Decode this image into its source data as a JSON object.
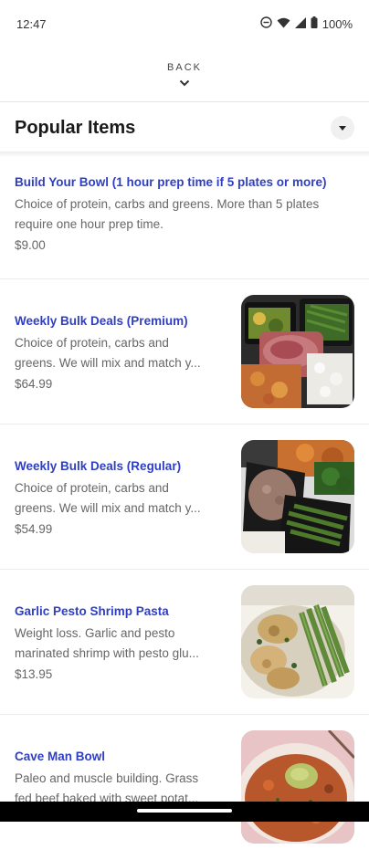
{
  "status_bar": {
    "time": "12:47",
    "battery": "100%",
    "icons": [
      "do-not-disturb-icon",
      "wifi-icon",
      "cell-signal-icon",
      "battery-icon"
    ]
  },
  "header": {
    "back_label": "BACK",
    "back_icon": "chevron-down-icon"
  },
  "section": {
    "title": "Popular Items",
    "toggle_icon": "caret-down-icon"
  },
  "items": [
    {
      "name": "Build Your Bowl (1 hour prep time if 5 plates or more)",
      "desc_line1": "Choice of protein, carbs and greens. More than 5 plates",
      "desc_line2": "require one hour prep time.",
      "price": "$9.00",
      "image": "none"
    },
    {
      "name": "Weekly Bulk Deals (Premium)",
      "desc_line1": "Choice of protein, carbs and",
      "desc_line2": "greens. We will mix and match y...",
      "price": "$64.99",
      "image": "meal-prep-steak-rice-tray"
    },
    {
      "name": "Weekly Bulk Deals (Regular)",
      "desc_line1": "Choice of protein, carbs and",
      "desc_line2": "greens. We will mix and match y...",
      "price": "$54.99",
      "image": "meal-prep-beans-broccoli-tray"
    },
    {
      "name": "Garlic Pesto Shrimp Pasta",
      "desc_line1": "Weight loss. Garlic and pesto",
      "desc_line2": "marinated shrimp with pesto glu...",
      "price": "$13.95",
      "image": "shrimp-asparagus-dish"
    },
    {
      "name": "Cave Man Bowl",
      "desc_line1": "Paleo and muscle building. Grass",
      "desc_line2": "fed beef baked with sweet potat...",
      "price": "",
      "image": "sweet-potato-beef-bowl"
    }
  ],
  "colors": {
    "item_name": "#2f3fc4",
    "muted_text": "#666666",
    "divider": "#ebebeb"
  }
}
